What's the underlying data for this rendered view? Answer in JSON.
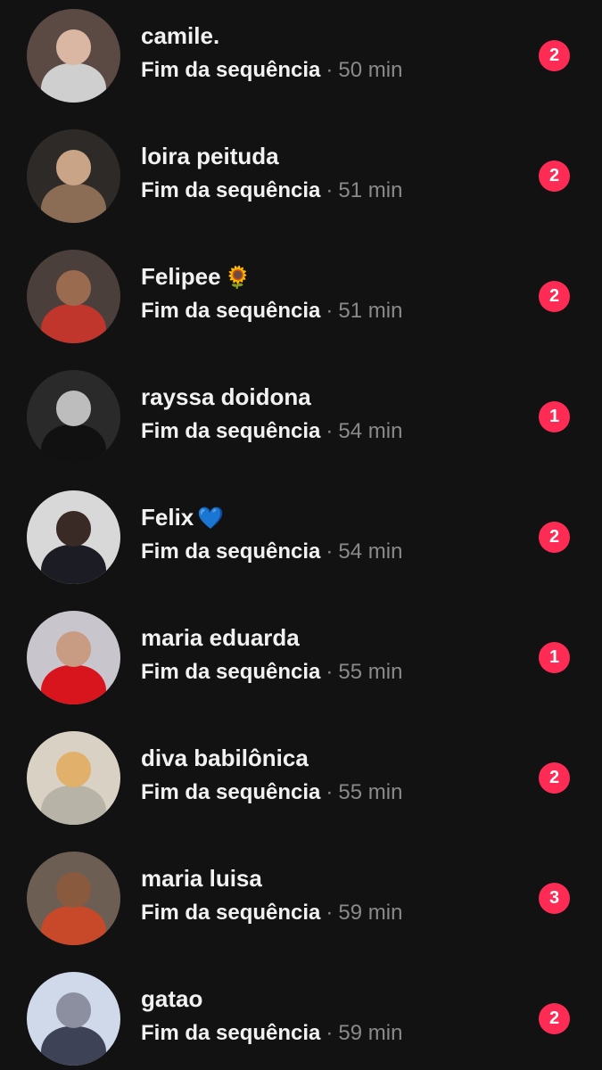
{
  "conversations": [
    {
      "name": "camile.",
      "emoji": "",
      "status": "Fim da sequência",
      "time": "50 min",
      "unread": "2",
      "avatar_bg": "#5b4a44",
      "avatar_fg": "#d9b7a2",
      "avatar_cloth": "#cfcfcf"
    },
    {
      "name": "loira peituda",
      "emoji": "",
      "status": "Fim da sequência",
      "time": "51 min",
      "unread": "2",
      "avatar_bg": "#2e2a28",
      "avatar_fg": "#c9a487",
      "avatar_cloth": "#8b6c55"
    },
    {
      "name": "Felipee",
      "emoji": "🌻",
      "status": "Fim da sequência",
      "time": "51 min",
      "unread": "2",
      "avatar_bg": "#4a3f3a",
      "avatar_fg": "#9b6b4f",
      "avatar_cloth": "#c0352c"
    },
    {
      "name": "rayssa doidona",
      "emoji": "",
      "status": "Fim da sequência",
      "time": "54 min",
      "unread": "1",
      "avatar_bg": "#2a2a2a",
      "avatar_fg": "#bdbdbd",
      "avatar_cloth": "#111111"
    },
    {
      "name": "Felix",
      "emoji": "💙",
      "status": "Fim da sequência",
      "time": "54 min",
      "unread": "2",
      "avatar_bg": "#d8d8d8",
      "avatar_fg": "#3a2a26",
      "avatar_cloth": "#1c1c24"
    },
    {
      "name": "maria eduarda",
      "emoji": "",
      "status": "Fim da sequência",
      "time": "55 min",
      "unread": "1",
      "avatar_bg": "#c9c5cc",
      "avatar_fg": "#c89b83",
      "avatar_cloth": "#d8141c"
    },
    {
      "name": "diva babilônica",
      "emoji": "",
      "status": "Fim da sequência",
      "time": "55 min",
      "unread": "2",
      "avatar_bg": "#d9d1c4",
      "avatar_fg": "#e1b06a",
      "avatar_cloth": "#b7b3a6"
    },
    {
      "name": "maria luisa",
      "emoji": "",
      "status": "Fim da sequência",
      "time": "59 min",
      "unread": "3",
      "avatar_bg": "#6d5e54",
      "avatar_fg": "#8a5a3f",
      "avatar_cloth": "#c8492a"
    },
    {
      "name": "gatao",
      "emoji": "",
      "status": "Fim da sequência",
      "time": "59 min",
      "unread": "2",
      "avatar_bg": "#cfd9ea",
      "avatar_fg": "#8c8fa0",
      "avatar_cloth": "#3d4256"
    }
  ]
}
